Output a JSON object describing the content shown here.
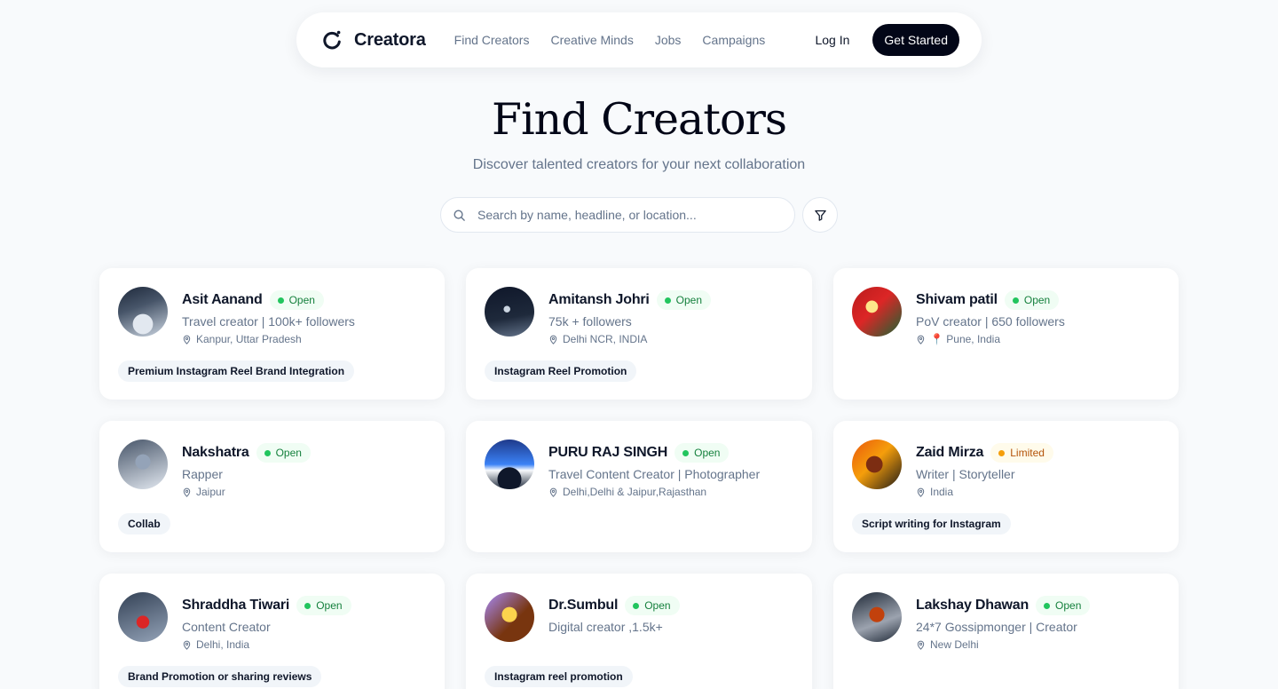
{
  "nav": {
    "brand": "Creatora",
    "links": [
      "Find Creators",
      "Creative Minds",
      "Jobs",
      "Campaigns"
    ],
    "login": "Log In",
    "cta": "Get Started"
  },
  "hero": {
    "title": "Find Creators",
    "subtitle": "Discover talented creators for your next collaboration"
  },
  "search": {
    "placeholder": "Search by name, headline, or location...",
    "value": ""
  },
  "icons": [
    "logo-icon",
    "search-icon",
    "filter-icon",
    "map-pin-icon",
    "red-pin-emoji"
  ],
  "colors": {
    "open": "#22c55e",
    "limited": "#f59e0b",
    "cta": "#020617"
  },
  "creators": [
    {
      "name": "Asit Aanand",
      "status": "Open",
      "headline": "Travel creator | 100k+ followers",
      "location": "Kanpur, Uttar Pradesh",
      "tag": "Premium Instagram Reel Brand Integration"
    },
    {
      "name": "Amitansh Johri",
      "status": "Open",
      "headline": "75k + followers",
      "location": "Delhi NCR, INDIA",
      "tag": "Instagram Reel Promotion"
    },
    {
      "name": "Shivam patil",
      "status": "Open",
      "headline": "PoV creator | 650 followers",
      "location": "📍 Pune, India",
      "tag": ""
    },
    {
      "name": "Nakshatra",
      "status": "Open",
      "headline": "Rapper",
      "location": "Jaipur",
      "tag": "Collab"
    },
    {
      "name": "PURU RAJ SINGH",
      "status": "Open",
      "headline": "Travel Content Creator | Photographer",
      "location": "Delhi,Delhi & Jaipur,Rajasthan",
      "tag": ""
    },
    {
      "name": "Zaid Mirza",
      "status": "Limited",
      "headline": "Writer | Storyteller",
      "location": "India",
      "tag": "Script writing for Instagram"
    },
    {
      "name": "Shraddha Tiwari",
      "status": "Open",
      "headline": "Content Creator",
      "location": "Delhi, India",
      "tag": "Brand Promotion or sharing reviews"
    },
    {
      "name": "Dr.Sumbul",
      "status": "Open",
      "headline": "Digital creator ,1.5k+",
      "location": "",
      "tag": "Instagram reel promotion"
    },
    {
      "name": "Lakshay Dhawan",
      "status": "Open",
      "headline": "24*7 Gossipmonger | Creator",
      "location": "New Delhi",
      "tag": ""
    }
  ]
}
